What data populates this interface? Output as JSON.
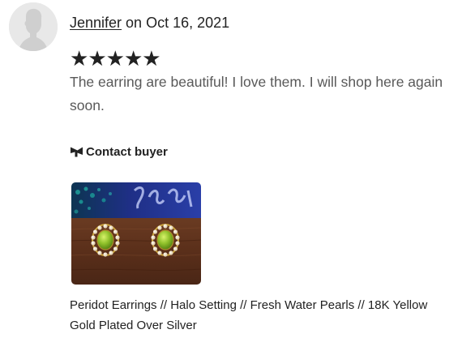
{
  "review": {
    "reviewer_name": "Jennifer",
    "date_text": " on Oct 16, 2021",
    "rating": 5,
    "rating_max": 5,
    "text": "The earring are beautiful! I love them. I will shop here again soon.",
    "contact_label": "Contact buyer",
    "contact_icon": "megaphone-icon",
    "avatar_icon": "default-user-avatar-icon"
  },
  "listing": {
    "title": "Peridot Earrings // Halo Setting // Fresh Water Pearls // 18K Yellow Gold Plated Over Silver",
    "image_alt": "Peridot Earrings // Halo Setting // Fresh Water Pearls // 18K Yellow Gold Plated Over Silver"
  },
  "colors": {
    "text_primary": "#222222",
    "text_secondary": "#595959",
    "avatar_bg": "#e8e8e8",
    "peridot_green": "#8fc02a",
    "gold": "#c9a23a"
  }
}
